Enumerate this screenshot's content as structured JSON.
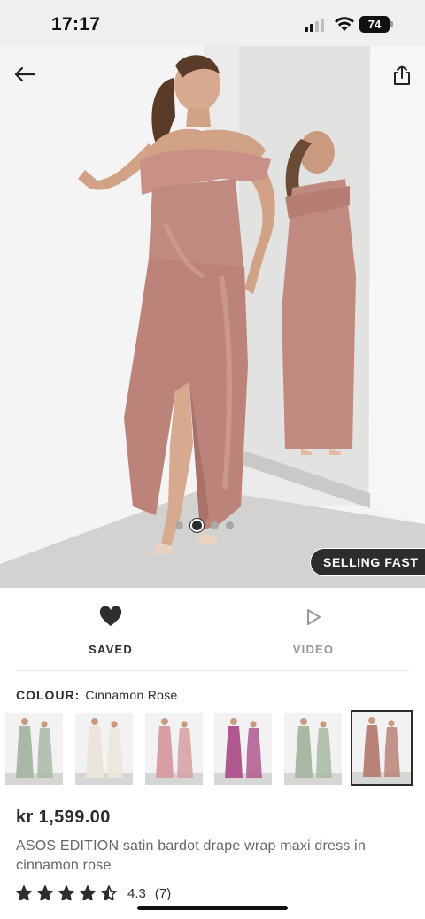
{
  "status_bar": {
    "time": "17:17",
    "battery_level": "74",
    "icons": [
      "signal-icon",
      "wifi-icon",
      "battery-icon"
    ]
  },
  "header": {
    "back_icon": "arrow-left-icon",
    "share_icon": "share-icon"
  },
  "gallery": {
    "total_images": 4,
    "active_index": 2,
    "badge": "SELLING FAST"
  },
  "actions": {
    "saved": {
      "label": "SAVED",
      "icon": "heart-filled-icon"
    },
    "video": {
      "label": "VIDEO",
      "icon": "play-outline-icon"
    }
  },
  "colour": {
    "label": "COLOUR:",
    "value": "Cinnamon Rose",
    "swatches": [
      {
        "colour_name": "sage",
        "dress_color": "#aab8a8"
      },
      {
        "colour_name": "ivory",
        "dress_color": "#ebe6dd"
      },
      {
        "colour_name": "blush",
        "dress_color": "#d79ea3"
      },
      {
        "colour_name": "magenta",
        "dress_color": "#b0588e"
      },
      {
        "colour_name": "sage green",
        "dress_color": "#a9b8a2"
      },
      {
        "colour_name": "cinnamon rose",
        "dress_color": "#b98279",
        "selected": true
      }
    ]
  },
  "product": {
    "price": "kr 1,599.00",
    "title": "ASOS EDITION satin bardot drape wrap maxi dress in cinnamon rose",
    "rating": {
      "stars": 4.5,
      "value": "4.3",
      "count": "(7)"
    }
  },
  "colors": {
    "dress": "#c08a81",
    "text_primary": "#2d2d2d",
    "text_secondary": "#666666",
    "badge_bg": "#2d2d2d"
  }
}
